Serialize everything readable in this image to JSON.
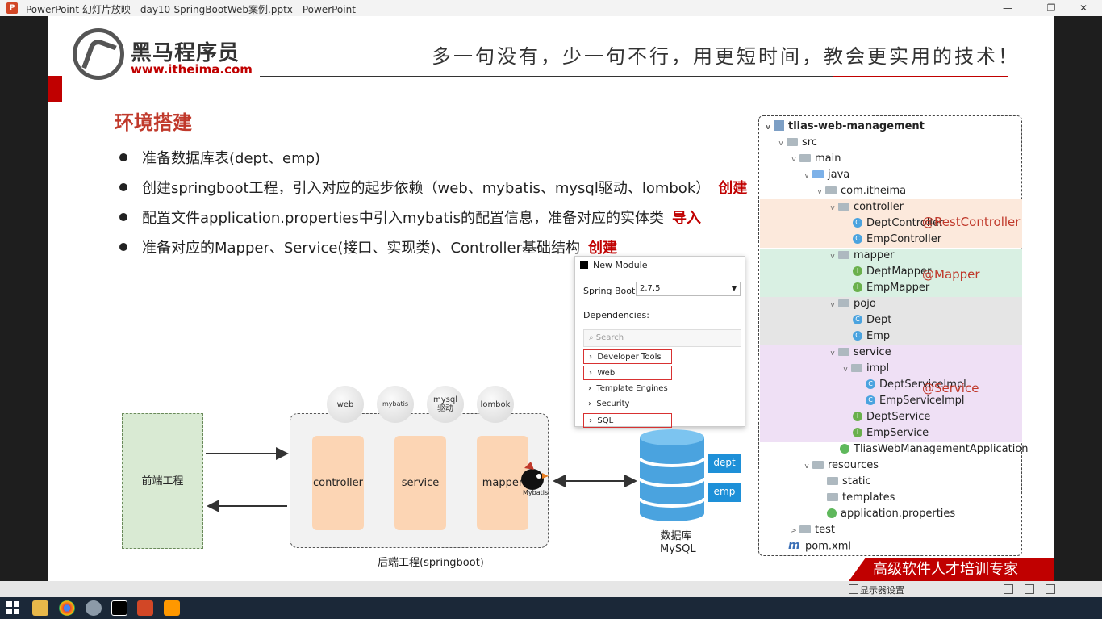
{
  "window": {
    "title": "PowerPoint 幻灯片放映  -  day10-SpringBootWeb案例.pptx - PowerPoint",
    "minimize": "—",
    "maximize": "❐",
    "close": "✕"
  },
  "logo": {
    "brand": "黑马程序员",
    "url": "www.itheima.com"
  },
  "slogan": "多一句没有，少一句不行，用更短时间，教会更实用的技术！",
  "heading": "环境搭建",
  "bullets": [
    {
      "text": "准备数据库表(dept、emp)",
      "note": ""
    },
    {
      "text": "创建springboot工程，引入对应的起步依赖（web、mybatis、mysql驱动、lombok）",
      "note": "创建"
    },
    {
      "text": "配置文件application.properties中引入mybatis的配置信息，准备对应的实体类",
      "note": "导入"
    },
    {
      "text": "准备对应的Mapper、Service(接口、实现类)、Controller基础结构",
      "note": "创建"
    }
  ],
  "new_module": {
    "title": "New Module",
    "spring_boot_label": "Spring Boot:",
    "spring_boot_version": "2.7.5",
    "dependencies_label": "Dependencies:",
    "search_placeholder": "Search",
    "items": [
      "Developer Tools",
      "Web",
      "Template Engines",
      "Security",
      "SQL"
    ]
  },
  "architecture": {
    "frontend": "前端工程",
    "backend_label": "后端工程(springboot)",
    "layers": [
      "controller",
      "service",
      "mapper"
    ],
    "deps": [
      "web",
      "mybatis",
      "mysql\n驱动",
      "lombok"
    ],
    "mybatis_badge": "Mybatis",
    "db_label": "数据库\nMySQL",
    "tables": [
      "dept",
      "emp"
    ]
  },
  "tree": {
    "root": "tlias-web-management",
    "rows": {
      "src": "src",
      "main": "main",
      "java": "java",
      "pkg": "com.itheima",
      "controller": "controller",
      "dept_controller": "DeptController",
      "emp_controller": "EmpController",
      "mapper": "mapper",
      "dept_mapper": "DeptMapper",
      "emp_mapper": "EmpMapper",
      "pojo": "pojo",
      "dept": "Dept",
      "emp": "Emp",
      "service": "service",
      "impl": "impl",
      "dept_service_impl": "DeptServiceImpl",
      "emp_service_impl": "EmpServiceImpl",
      "dept_service": "DeptService",
      "emp_service": "EmpService",
      "app": "TliasWebManagementApplication",
      "resources": "resources",
      "static": "static",
      "templates": "templates",
      "props": "application.properties",
      "test": "test",
      "pom": "pom.xml"
    },
    "annotations": {
      "controller": "@RestController",
      "mapper": "@Mapper",
      "service": "@Service"
    }
  },
  "banner": "高级软件人才培训专家",
  "show_bar": {
    "label": "显示器设置"
  },
  "colors": {
    "accent_red": "#c00000",
    "controller_band": "#fce9dc",
    "mapper_band": "#d9f0e3",
    "pojo_band": "#e5e5e5",
    "service_band": "#efe0f5"
  }
}
